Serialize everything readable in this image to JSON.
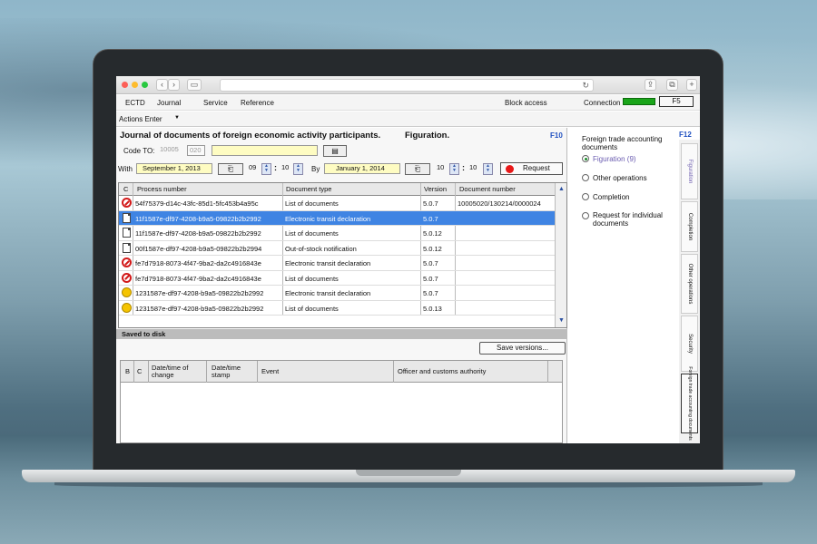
{
  "menu": {
    "items": [
      "ECTD",
      "Journal",
      "Service",
      "Reference"
    ],
    "block_access": "Block access",
    "connection": "Connection",
    "f5": "F5",
    "actions_enter": "Actions Enter"
  },
  "main": {
    "title": "Journal of documents of foreign economic activity participants.",
    "subtitle": "Figuration.",
    "f10": "F10",
    "code_to_label": "Code TO:",
    "code_to_value": "10005",
    "code_to_suffix": "020",
    "with_label": "With",
    "with_date": "September 1, 2013",
    "with_hour": "09",
    "with_min": "10",
    "by_label": "By",
    "by_date": "January 1, 2014",
    "by_hour": "10",
    "by_min": "10",
    "request_label": "Request"
  },
  "table": {
    "columns": [
      "C",
      "Process number",
      "Document type",
      "Version",
      "Document number"
    ],
    "rows": [
      {
        "icon": "blocked-icon",
        "process": "54f75379-d14c-43fc-85d1-5fc453b4a95c",
        "type": "List of documents",
        "version": "5.0.7",
        "docnum": "10005020/130214/0000024"
      },
      {
        "icon": "document-icon",
        "process": "11f1587e-df97-4208-b9a5-09822b2b2992",
        "type": "Electronic transit declaration",
        "version": "5.0.7",
        "docnum": ""
      },
      {
        "icon": "document-icon",
        "process": "11f1587e-df97-4208-b9a5-09822b2b2992",
        "type": "List of documents",
        "version": "5.0.12",
        "docnum": ""
      },
      {
        "icon": "document-icon",
        "process": "00f1587e-df97-4208-b9a5-09822b2b2994",
        "type": "Out-of-stock notification",
        "version": "5.0.12",
        "docnum": ""
      },
      {
        "icon": "blocked-icon",
        "process": "fe7d7918-8073-4f47-9ba2-da2c4916843e",
        "type": "Electronic transit declaration",
        "version": "5.0.7",
        "docnum": ""
      },
      {
        "icon": "blocked-icon",
        "process": "fe7d7918-8073-4f47-9ba2-da2c4916843e",
        "type": "List of documents",
        "version": "5.0.7",
        "docnum": ""
      },
      {
        "icon": "pending-icon",
        "process": "1231587e-df97-4208-b9a5-09822b2b2992",
        "type": "Electronic transit declaration",
        "version": "5.0.7",
        "docnum": ""
      },
      {
        "icon": "pending-icon",
        "process": "1231587e-df97-4208-b9a5-09822b2b2992",
        "type": "List of documents",
        "version": "5.0.13",
        "docnum": ""
      }
    ]
  },
  "saved": {
    "title": "Saved to disk",
    "save_versions": "Save versions...",
    "columns": [
      "B",
      "C",
      "Date/time of change",
      "Date/time stamp",
      "Event",
      "Officer and customs authority"
    ]
  },
  "right": {
    "f12": "F12",
    "heading": "Foreign trade accounting documents",
    "options": [
      "Figuration (9)",
      "Other operations",
      "Completion",
      "Request for individual documents"
    ],
    "tabs": [
      "Figuration",
      "Completion",
      "Other operations",
      "Security",
      "Foreign trade accounting documents"
    ]
  },
  "colors": {
    "selection": "#3f84e3",
    "connection": "#1aa51a",
    "yellow_field": "#fefcc2",
    "link": "#2050c0"
  }
}
